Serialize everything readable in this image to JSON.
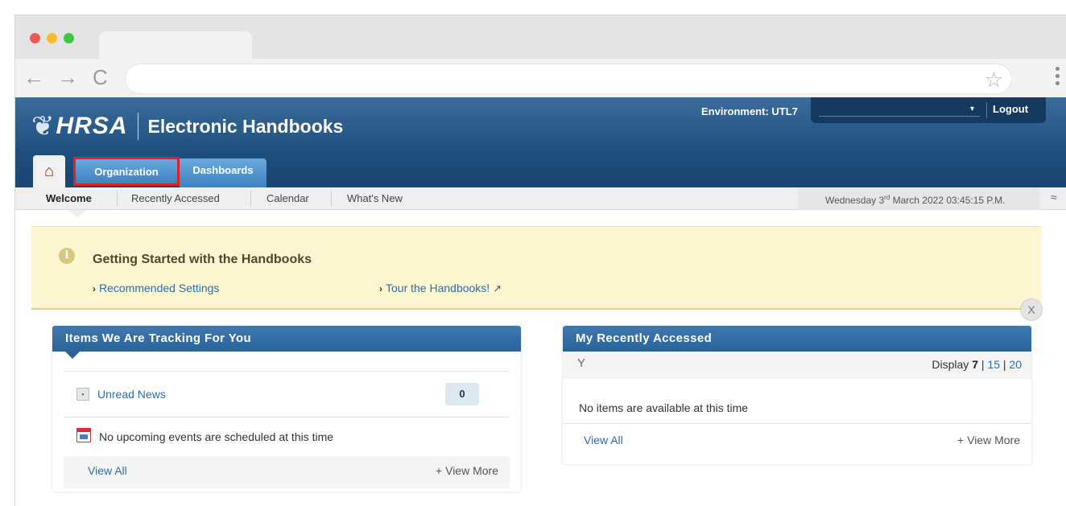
{
  "browser": {
    "nav": {
      "back": "←",
      "forward": "→",
      "reload": "C",
      "bookmark": "☆"
    }
  },
  "header": {
    "logo_text": "HRSA",
    "app_title": "Electronic Handbooks",
    "environment": "Environment: UTL7",
    "logout": "Logout",
    "tabs": {
      "organization": "Organization",
      "dashboards": "Dashboards"
    },
    "home_icon": "⌂"
  },
  "subnav": {
    "items": [
      "Welcome",
      "Recently Accessed",
      "Calendar",
      "What's New"
    ],
    "date_prefix": "Wednesday 3",
    "date_sup": "rd",
    "date_suffix": " March 2022 03:45:15 P.M.",
    "collapse": "≈"
  },
  "banner": {
    "title": "Getting Started with the Handbooks",
    "link1": "Recommended Settings",
    "link2": "Tour the Handbooks!",
    "external": "↗",
    "close": "X",
    "info": "i"
  },
  "tracking": {
    "title": "Items We Are Tracking For You",
    "unread_label": "Unread News",
    "unread_count": "0",
    "events_text": "No upcoming events are scheduled at this time",
    "view_all": "View All",
    "view_more": "+ View More"
  },
  "recent": {
    "title": "My Recently Accessed",
    "filter": "Y",
    "display_label": "Display",
    "display_options": [
      "7",
      "15",
      "20"
    ],
    "display_sep": "|",
    "empty_text": "No items are available at this time",
    "view_all": "View All",
    "view_more": "+ View More"
  }
}
